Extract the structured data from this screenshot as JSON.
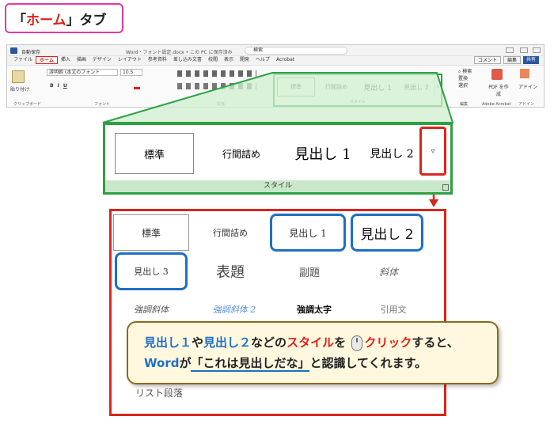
{
  "heading": {
    "open_quote": "「",
    "red_text": "ホーム",
    "close_quote": "」",
    "suffix": "タブ"
  },
  "ribbon": {
    "autosave": "自動保存",
    "doc_title": "Word・フォント設定.docx • この PC に保存済み",
    "search_placeholder": "検索",
    "tabs": [
      "ファイル",
      "ホーム",
      "挿入",
      "描画",
      "デザイン",
      "レイアウト",
      "参考資料",
      "差し込み文書",
      "校閲",
      "表示",
      "開発",
      "ヘルプ",
      "Acrobat"
    ],
    "selected_tab": "ホーム",
    "clipboard": {
      "paste": "貼り付け",
      "label": "クリップボード"
    },
    "font": {
      "name": "游明朝 (本文のフォント",
      "size": "10.5",
      "label": "フォント",
      "b": "B",
      "i": "I",
      "u": "U"
    },
    "paragraph": {
      "label": "段落"
    },
    "styles": {
      "items": [
        "標準",
        "行間詰め",
        "見出し 1",
        "見出し 2"
      ],
      "label": "スタイル"
    },
    "editing": {
      "find": "検索",
      "replace": "置換",
      "select": "選択",
      "label": "編集"
    },
    "acrobat": {
      "pdf": "PDF を作成",
      "label": "Adobe Acrobat"
    },
    "addin": {
      "item": "アドイン",
      "label": "アドイン"
    },
    "comment": "コメント",
    "edit": "編集",
    "share": "共有"
  },
  "zoom_panel": {
    "items": [
      "標準",
      "行間詰め",
      "見出し 1",
      "見出し 2"
    ],
    "footer": "スタイル",
    "more_icon": "▿"
  },
  "gallery": {
    "items": [
      "標準",
      "行間詰め",
      "見出し 1",
      "見出し 2",
      "見出し 3",
      "表題",
      "副題",
      "斜体",
      "強調斜体",
      "強調斜体 2",
      "強調太字",
      "引用文"
    ],
    "partial": "リスト段落"
  },
  "callout": {
    "l1_a": "見出し１",
    "l1_b": "や",
    "l1_c": "見出し２",
    "l1_d": "などの",
    "l1_e": "スタイル",
    "l1_f": "を",
    "l1_g": "クリック",
    "l1_h": "すると、",
    "l2_a": "Word",
    "l2_b": "が",
    "l2_c": "「これは見出しだな」",
    "l2_d": "と認識してくれます。"
  },
  "colors": {
    "green": "#2ea043",
    "red": "#d9261c",
    "blue": "#1f6fc5",
    "pink": "#e23aa2"
  }
}
